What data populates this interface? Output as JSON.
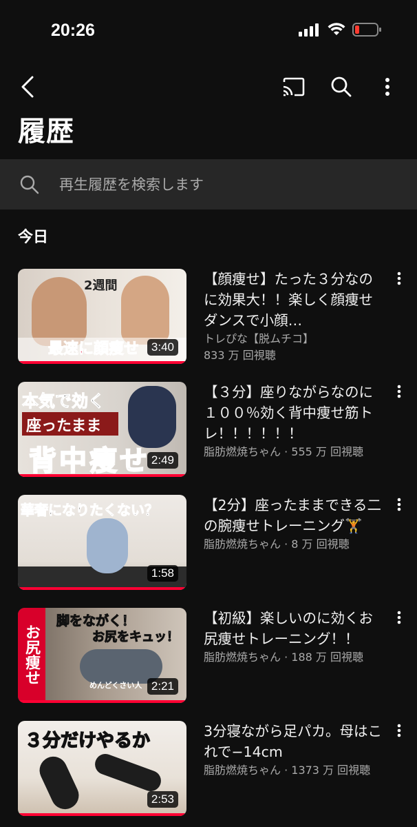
{
  "status": {
    "time": "20:26"
  },
  "page": {
    "title": "履歴"
  },
  "search": {
    "placeholder": "再生履歴を検索します"
  },
  "section": {
    "today": "今日"
  },
  "videos": [
    {
      "title": "【顔痩せ】たった３分なのに効果大！！楽しく顔痩せダンスで小顔…",
      "channel": "トレぴな【脱ムチコ】",
      "views": "833 万 回視聴",
      "duration": "3:40",
      "overlay": [
        "2週間",
        "最速に顔痩せ"
      ]
    },
    {
      "title": "【３分】座りながらなのに１００％効く背中痩せ筋トレ！！！！！！",
      "channel": "脂肪燃焼ちゃん · 555 万 回視聴",
      "views": "",
      "duration": "2:49",
      "overlay": [
        "本気で効く",
        "座ったまま",
        "背中痩せ"
      ]
    },
    {
      "title": "【2分】座ったままできる二の腕痩せトレーニング🏋️",
      "channel": "脂肪燃焼ちゃん · 8 万 回視聴",
      "views": "",
      "duration": "1:58",
      "overlay": [
        "華奢になりたくない？"
      ]
    },
    {
      "title": "【初級】楽しいのに効くお尻痩せトレーニング！！",
      "channel": "脂肪燃焼ちゃん · 188 万 回視聴",
      "views": "",
      "duration": "2:21",
      "overlay": [
        "脚をながく！",
        "お尻をキュッ！",
        "お尻痩せ",
        "めんどくさい人"
      ]
    },
    {
      "title": "3分寝ながら足パカ。母はこれで−14cm",
      "channel": "脂肪燃焼ちゃん · 1373 万 回視聴",
      "views": "",
      "duration": "2:53",
      "overlay": [
        "３分だけやるか"
      ]
    }
  ],
  "colors": {
    "background": "#0f0f0f",
    "surface": "#272727",
    "accent": "#ff0033",
    "secondary_text": "#aaaaaa"
  },
  "icons": [
    "back-icon",
    "cast-icon",
    "search-icon",
    "more-vertical-icon",
    "signal-icon",
    "wifi-icon",
    "battery-icon"
  ]
}
